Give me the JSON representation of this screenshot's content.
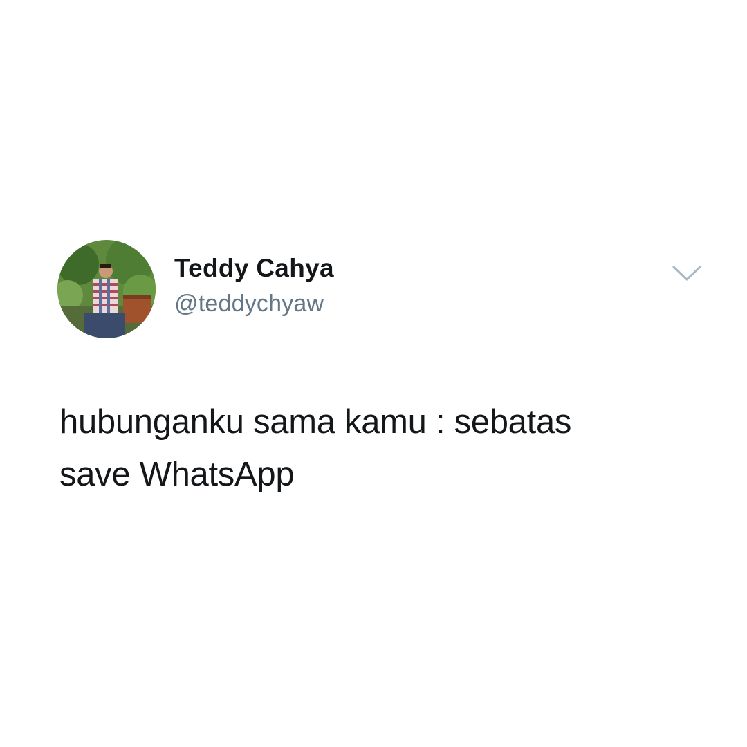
{
  "tweet": {
    "author": {
      "display_name": "Teddy Cahya",
      "handle": "@teddychyaw",
      "avatar_icon": "profile-photo"
    },
    "text_lines": [
      "hubunganku sama kamu : sebatas",
      "save WhatsApp"
    ],
    "menu_icon": "chevron-down-icon"
  },
  "colors": {
    "background": "#ffffff",
    "name": "#14171a",
    "handle": "#657786",
    "chevron": "#aab8c2"
  }
}
